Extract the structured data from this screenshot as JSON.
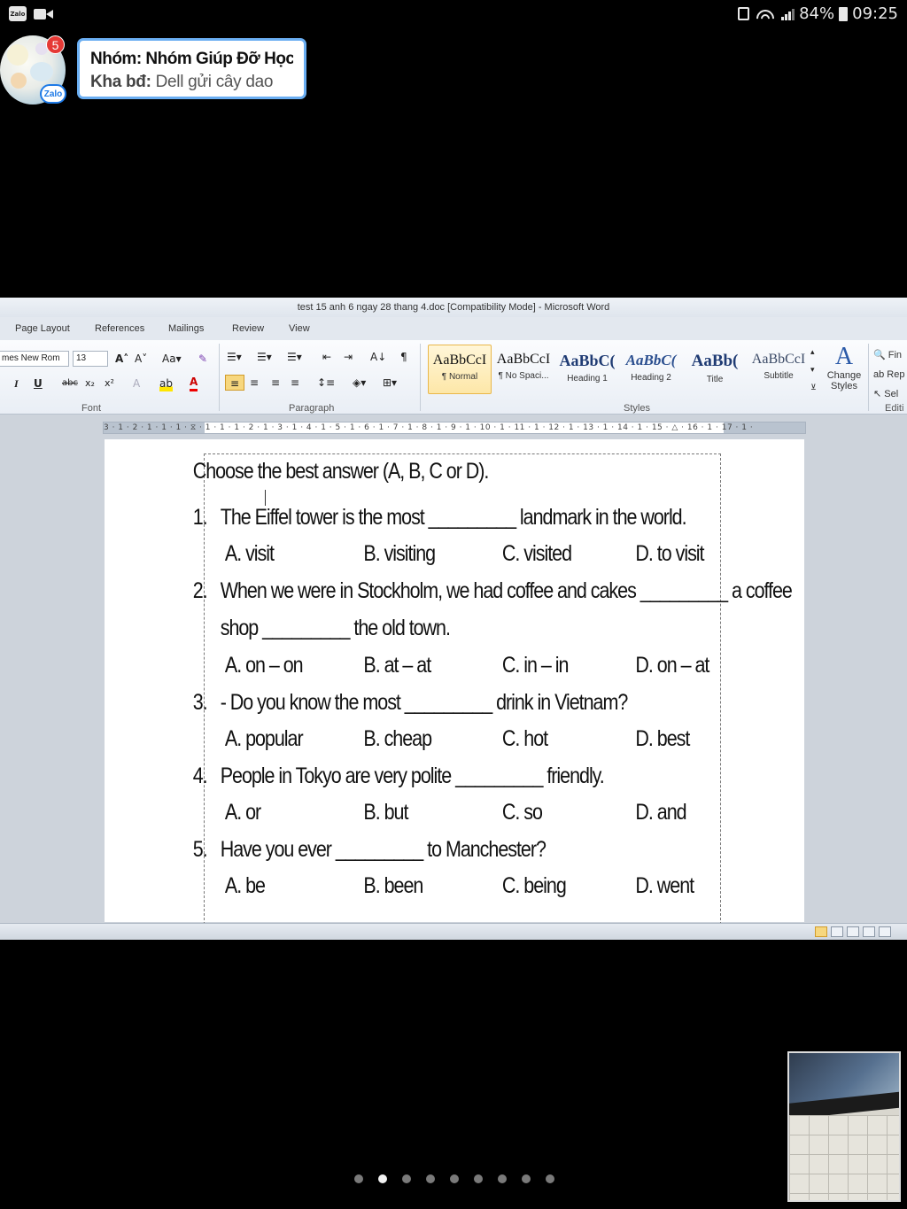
{
  "status_bar": {
    "battery": "84%",
    "time": "09:25",
    "left_icons": [
      "zalo-icon",
      "video-call-icon"
    ],
    "right_icons": [
      "lock-icon",
      "wifi-icon",
      "signal-icon",
      "battery-icon"
    ]
  },
  "chat_head": {
    "unread_count": "5",
    "app_badge": "Zalo"
  },
  "notification": {
    "title": "Nhóm: Nhóm Giúp Đỡ Học ...",
    "sender": "Kha bđ:",
    "message": "Dell gửi cây dao"
  },
  "word": {
    "title": "test 15 anh 6 ngay 28 thang 4.doc [Compatibility Mode]  -  Microsoft Word",
    "tabs": [
      "Page Layout",
      "References",
      "Mailings",
      "Review",
      "View"
    ],
    "font_name": "mes New Rom",
    "font_size": "13",
    "groups": [
      "Font",
      "Paragraph",
      "Styles",
      "Editi"
    ],
    "styles": [
      {
        "sample": "AaBbCcI",
        "name": "¶ Normal"
      },
      {
        "sample": "AaBbCcI",
        "name": "¶ No Spaci..."
      },
      {
        "sample": "AaBbC(",
        "name": "Heading 1"
      },
      {
        "sample": "AaBbC(",
        "name": "Heading 2"
      },
      {
        "sample": "AaBb(",
        "name": "Title"
      },
      {
        "sample": "AaBbCcI",
        "name": "Subtitle"
      }
    ],
    "change_styles": "Change Styles",
    "editing": [
      "Fin",
      "Rep",
      "Sel"
    ],
    "ruler_text": "3 · 1 · 2 · 1 · 1 · 1 · ⧖ · 1 · 1 · 1 · 2 · 1 · 3 · 1 · 4 · 1 · 5 · 1 · 6 · 1 · 7 · 1 · 8 · 1 · 9 · 1 · 10 · 1 · 11 · 1 · 12 · 1 · 13 · 1 · 14 · 1 · 15 · △ · 16 · 1 · 17 · 1 ·"
  },
  "document": {
    "heading": "Choose the best answer (A, B, C or D).",
    "questions": [
      {
        "num": "1.",
        "lines": [
          "The Eiffel tower is the most _________ landmark in the world."
        ],
        "options": [
          "A.  visit",
          "B.  visiting",
          "C.  visited",
          "D.  to visit"
        ]
      },
      {
        "num": "2.",
        "lines": [
          "When we were in Stockholm, we had coffee and cakes _________ a coffee",
          "shop _________ the old town."
        ],
        "options": [
          "A.  on – on",
          "B.  at – at",
          "C.  in – in",
          "D.  on – at"
        ]
      },
      {
        "num": "3.",
        "lines": [
          "- Do you know the most _________ drink in Vietnam?"
        ],
        "options": [
          "A.  popular",
          "B.  cheap",
          "C.  hot",
          "D.  best"
        ]
      },
      {
        "num": "4.",
        "lines": [
          "People in Tokyo are very polite _________ friendly."
        ],
        "options": [
          "A.  or",
          "B.  but",
          "C.  so",
          "D.  and"
        ]
      },
      {
        "num": "5.",
        "lines": [
          "Have you ever _________ to Manchester?"
        ],
        "options": [
          "A.  be",
          "B.  been",
          "C.  being",
          "D.  went"
        ]
      }
    ]
  },
  "pager": {
    "count": 9,
    "active_index": 1
  }
}
